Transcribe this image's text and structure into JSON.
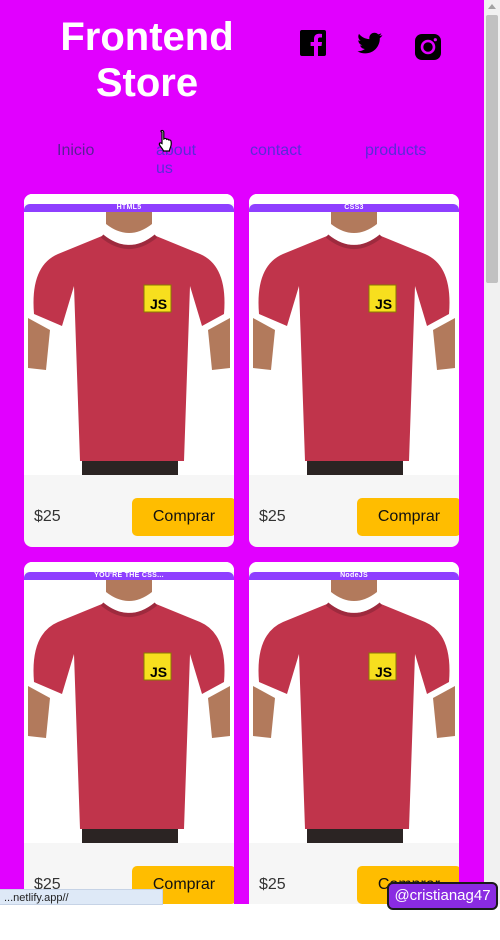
{
  "header": {
    "title_line1": "Frontend",
    "title_line2": "Store",
    "social": [
      {
        "icon": "facebook-icon"
      },
      {
        "icon": "twitter-icon"
      },
      {
        "icon": "instagram-icon"
      }
    ]
  },
  "nav": {
    "links": [
      {
        "label": "Inicio"
      },
      {
        "label": "about us"
      },
      {
        "label": "contact"
      },
      {
        "label": "products"
      }
    ]
  },
  "products": [
    {
      "tag": "HTML5",
      "price": "$25",
      "buy_label": "Comprar",
      "image_badge": "JS"
    },
    {
      "tag": "CSS3",
      "price": "$25",
      "buy_label": "Comprar",
      "image_badge": "JS"
    },
    {
      "tag": "YOU'RE THE CSS...",
      "price": "$25",
      "buy_label": "Comprar",
      "image_badge": "JS"
    },
    {
      "tag": "NodeJS",
      "price": "$25",
      "buy_label": "Comprar",
      "image_badge": "JS"
    }
  ],
  "status_bar": {
    "url": "...netlify.app//"
  },
  "watermark": {
    "handle": "@cristianag47"
  },
  "colors": {
    "background": "#e100ff",
    "tag": "#8f3fff",
    "button": "#ffbd00",
    "shirt": "#c0344b",
    "js_badge": "#f7df1e"
  }
}
